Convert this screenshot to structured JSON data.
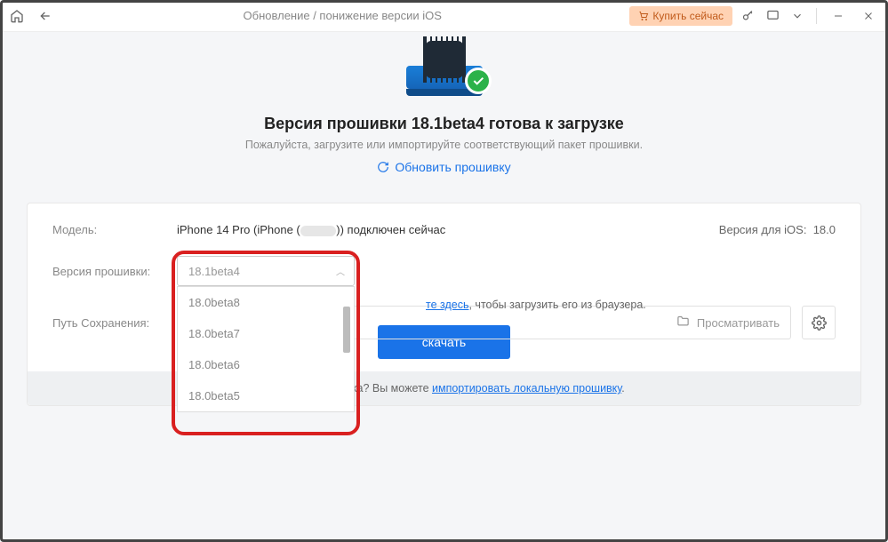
{
  "titlebar": {
    "title": "Обновление / понижение версии iOS",
    "buy": "Купить сейчас"
  },
  "hero": {
    "heading": "Версия прошивки 18.1beta4 готова к загрузке",
    "subtitle": "Пожалуйста, загрузите или импортируйте соответствующий пакет прошивки.",
    "refresh": "Обновить прошивку"
  },
  "panel": {
    "model_label": "Модель:",
    "model_value_prefix": "iPhone 14 Pro (iPhone (",
    "model_value_suffix": ")) подключен сейчас",
    "ios_label": "Версия для iOS:",
    "ios_value": "18.0",
    "fw_label": "Версия прошивки:",
    "fw_selected": "18.1beta4",
    "fw_options": [
      "18.0beta8",
      "18.0beta7",
      "18.0beta6",
      "18.0beta5"
    ],
    "path_label": "Путь Сохранения:",
    "browse": "Просматривать",
    "hint_link": "те здесь",
    "hint_rest": ", чтобы загрузить его из браузера.",
    "download": "скачать"
  },
  "footer": {
    "prefix": "Уже есть прошивка? Вы можете ",
    "link": "импортировать локальную прошивку",
    "suffix": "."
  }
}
